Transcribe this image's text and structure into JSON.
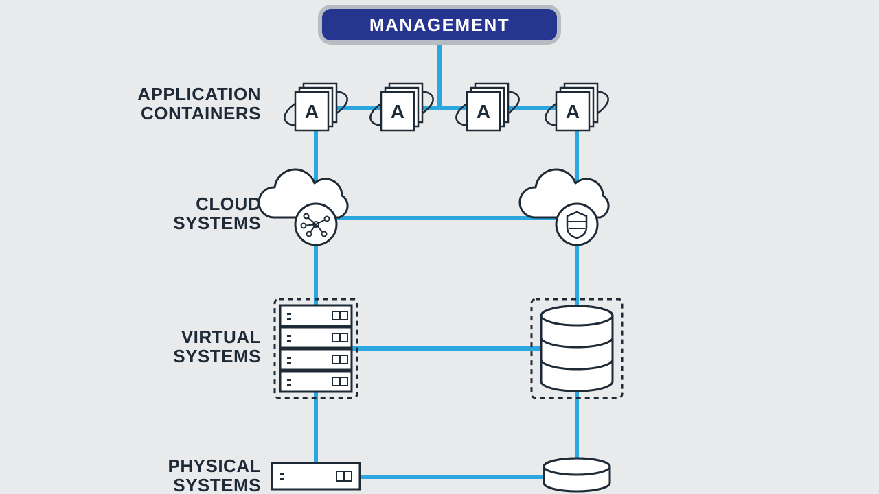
{
  "colors": {
    "line": "#2aa7df",
    "mgmt_fill": "#26358f",
    "mgmt_border": "#b7bcc3",
    "ink": "#1f2a37",
    "bg_page": "#e9eaec",
    "panel_white": "#ffffff"
  },
  "management": {
    "label": "MANAGEMENT"
  },
  "rows": {
    "containers": {
      "line1": "APPLICATION",
      "line2": "CONTAINERS",
      "icon_letter": "A"
    },
    "cloud": {
      "line1": "CLOUD",
      "line2": "SYSTEMS"
    },
    "virtual": {
      "line1": "VIRTUAL",
      "line2": "SYSTEMS"
    },
    "physical": {
      "line1": "PHYSICAL",
      "line2": "SYSTEMS"
    }
  }
}
